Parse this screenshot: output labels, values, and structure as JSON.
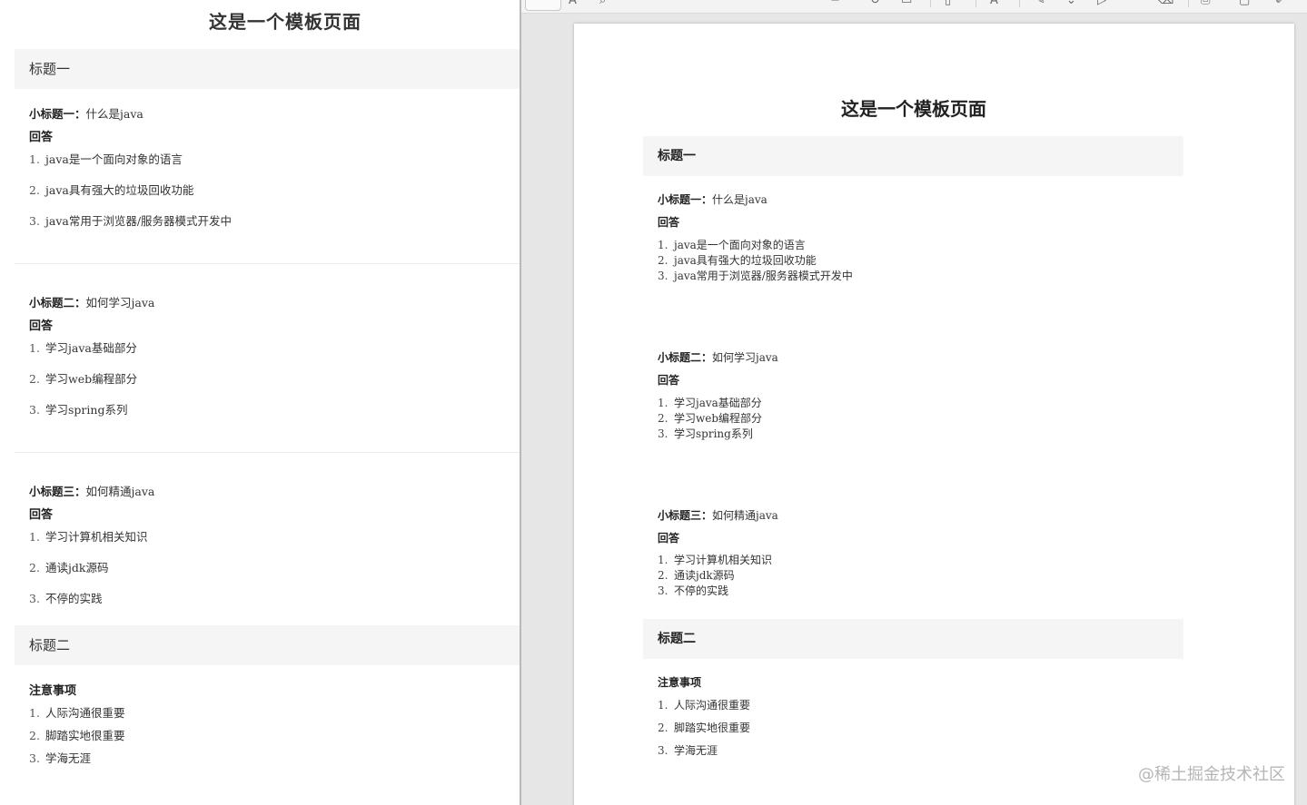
{
  "left": {
    "title": "这是一个模板页面",
    "section1": {
      "heading": "标题一",
      "q1": {
        "label": "小标题一：",
        "text": "什么是java",
        "answer": "回答",
        "items": [
          "java是一个面向对象的语言",
          "java具有强大的垃圾回收功能",
          "java常用于浏览器/服务器模式开发中"
        ]
      },
      "q2": {
        "label": "小标题二：",
        "text": "如何学习java",
        "answer": "回答",
        "items": [
          "学习java基础部分",
          "学习web编程部分",
          "学习spring系列"
        ]
      },
      "q3": {
        "label": "小标题三：",
        "text": "如何精通java",
        "answer": "回答",
        "items": [
          "学习计算机相关知识",
          "通读jdk源码",
          "不停的实践"
        ]
      }
    },
    "section2": {
      "heading": "标题二",
      "subheading": "注意事项",
      "items": [
        "人际沟通很重要",
        "脚踏实地很重要",
        "学海无涯"
      ]
    }
  },
  "preview": {
    "title": "这是一个模板页面",
    "section1": {
      "heading": "标题一",
      "q1": {
        "label": "小标题一：",
        "text": "什么是java",
        "answer": "回答",
        "items": [
          "java是一个面向对象的语言",
          "java具有强大的垃圾回收功能",
          "java常用于浏览器/服务器模式开发中"
        ]
      },
      "q2": {
        "label": "小标题二：",
        "text": "如何学习java",
        "answer": "回答",
        "items": [
          "学习java基础部分",
          "学习web编程部分",
          "学习spring系列"
        ]
      },
      "q3": {
        "label": "小标题三：",
        "text": "如何精通java",
        "answer": "回答",
        "items": [
          "学习计算机相关知识",
          "通读jdk源码",
          "不停的实践"
        ]
      }
    },
    "section2": {
      "heading": "标题二",
      "subheading": "注意事项",
      "items": [
        "人际沟通很重要",
        "脚踏实地很重要",
        "学海无涯"
      ]
    }
  },
  "numbers": [
    "1.",
    "2.",
    "3."
  ],
  "watermark": "@稀土掘金技术社区"
}
